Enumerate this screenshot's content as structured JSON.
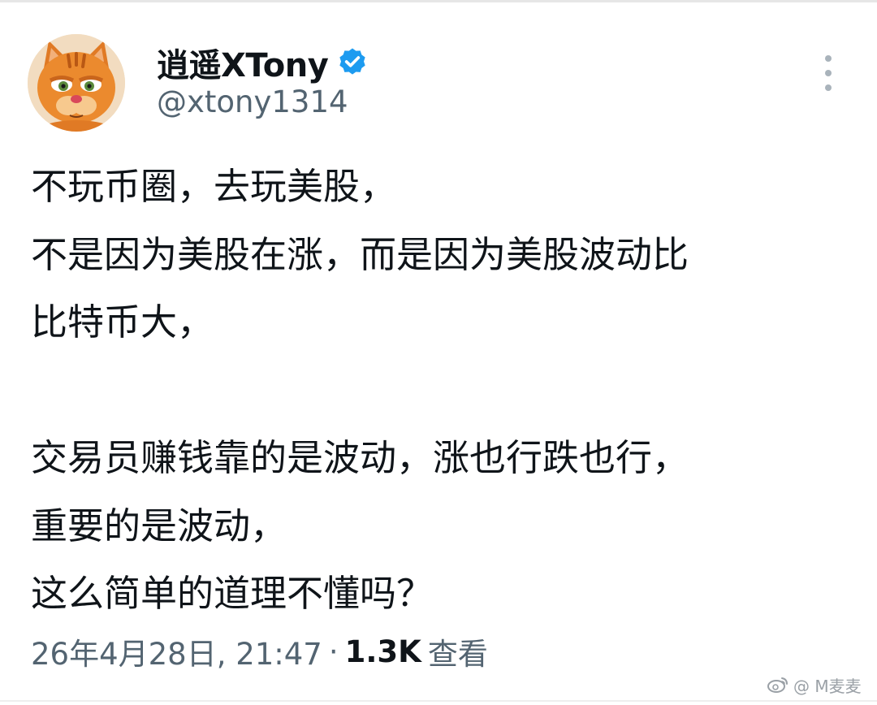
{
  "author": {
    "display_name": "逍遥XTony",
    "handle": "@xtony1314",
    "verified": true,
    "avatar": "garfield-cat-avatar"
  },
  "tweet": {
    "lines": [
      "不玩币圈，去玩美股，",
      "不是因为美股在涨，而是因为美股波动比",
      "比特币大，",
      "",
      "交易员赚钱靠的是波动，涨也行跌也行，",
      "重要的是波动，",
      "这么简单的道理不懂吗？"
    ]
  },
  "meta": {
    "timestamp": "26年4月28日, 21:47",
    "separator": "·",
    "views_count": "1.3K",
    "views_label": "查看"
  },
  "watermark": {
    "text": "@ M麦麦"
  },
  "colors": {
    "text_primary": "#0f1419",
    "text_secondary": "#536471",
    "verified_blue": "#1d9bf0",
    "icon_gray": "#a9b3bb"
  },
  "icons": {
    "verified": "verified-badge-icon",
    "more": "more-vertical-icon",
    "watermark_logo": "weibo-logo-icon"
  }
}
